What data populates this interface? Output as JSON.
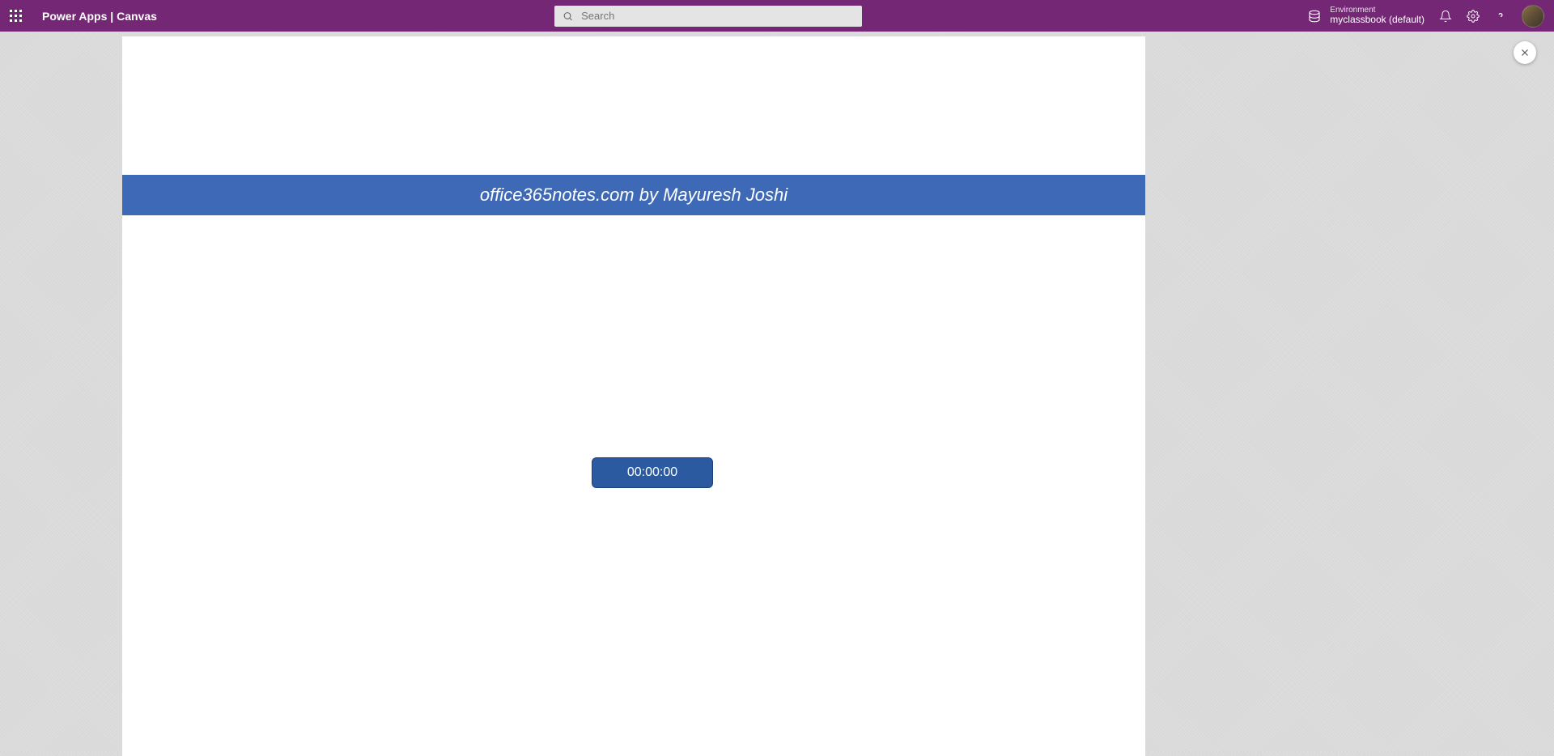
{
  "header": {
    "app_title": "Power Apps  |  Canvas",
    "search_placeholder": "Search",
    "environment": {
      "label": "Environment",
      "value": "myclassbook (default)"
    }
  },
  "canvas": {
    "banner_text": "office365notes.com by Mayuresh Joshi",
    "timer_value": "00:00:00"
  }
}
